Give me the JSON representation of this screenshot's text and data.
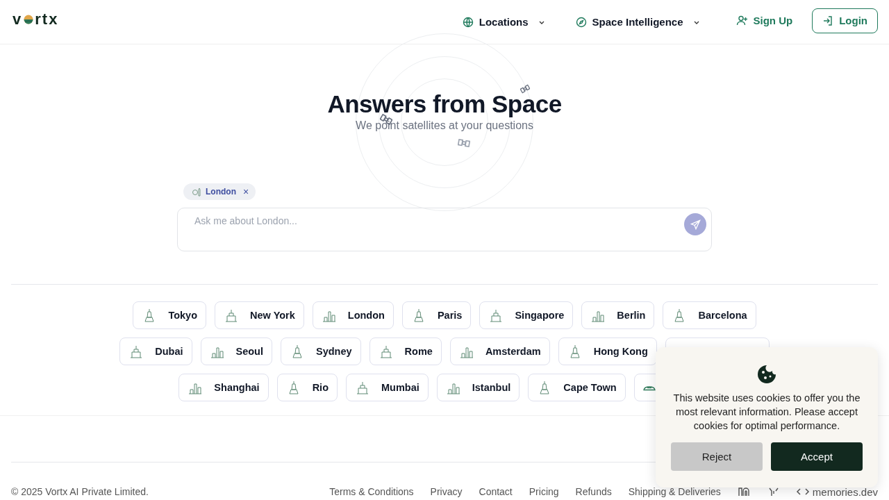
{
  "logo": {
    "start": "v",
    "end": "rtx"
  },
  "nav": [
    {
      "label": "Locations"
    },
    {
      "label": "Space Intelligence"
    }
  ],
  "auth": {
    "signup": "Sign Up",
    "login": "Login"
  },
  "hero": {
    "title": "Answers from Space",
    "subtitle": "We point satellites at your questions"
  },
  "selected_city": {
    "label": "London",
    "remove": "×"
  },
  "ask": {
    "placeholder": "Ask me about London..."
  },
  "city_rows": [
    [
      {
        "label": "Tokyo"
      },
      {
        "label": "New York"
      },
      {
        "label": "London"
      },
      {
        "label": "Paris"
      },
      {
        "label": "Singapore"
      },
      {
        "label": "Berlin"
      },
      {
        "label": "Barcelona"
      }
    ],
    [
      {
        "label": "Dubai"
      },
      {
        "label": "Seoul"
      },
      {
        "label": "Sydney"
      },
      {
        "label": "Rome"
      },
      {
        "label": "Amsterdam"
      },
      {
        "label": "Hong Kong"
      },
      {
        "kind": "covered"
      }
    ],
    [
      {
        "label": "Shanghai"
      },
      {
        "label": "Rio"
      },
      {
        "label": "Mumbai"
      },
      {
        "label": "Istanbul"
      },
      {
        "label": "Cape Town"
      },
      {
        "kind": "covered"
      }
    ]
  ],
  "footer": {
    "copyright": "© 2025 Vortx AI Private Limited.",
    "links": [
      "Terms & Conditions",
      "Privacy",
      "Contact",
      "Pricing",
      "Refunds",
      "Shipping & Deliveries"
    ],
    "memories": "memories.dev"
  },
  "cookie": {
    "text": "This website uses cookies to offer you the most relevant information. Please accept cookies for optimal performance.",
    "reject": "Reject",
    "accept": "Accept"
  }
}
